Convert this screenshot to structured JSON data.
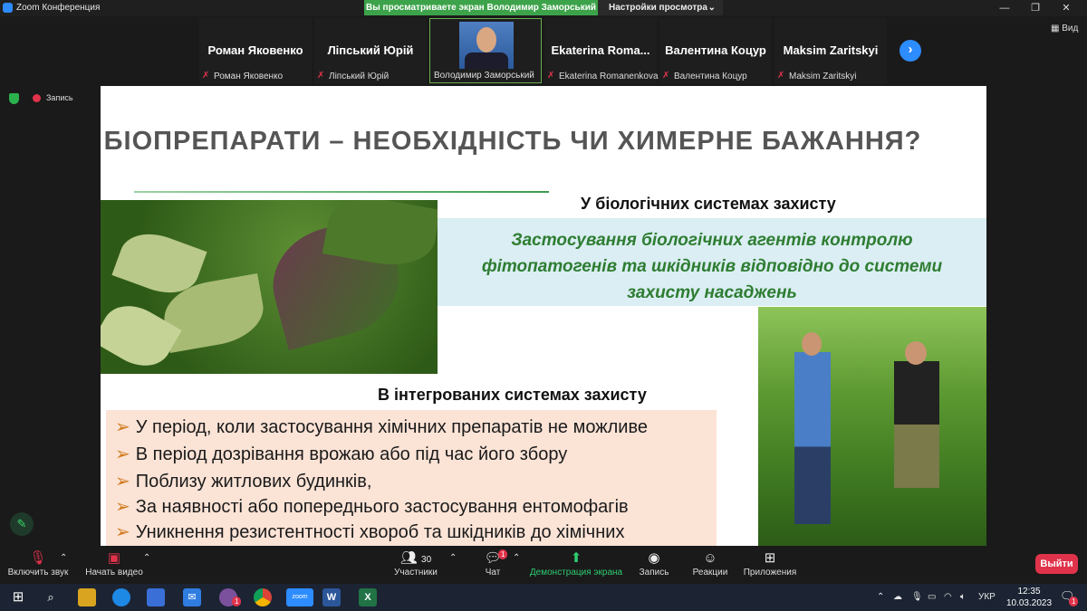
{
  "window": {
    "title": "Zoom Конференция",
    "share_banner": "Вы просматриваете экран Володимир Заморський",
    "view_settings": "Настройки просмотра",
    "minimize": "—",
    "maximize": "❐",
    "close": "✕"
  },
  "participants": [
    {
      "display": "Роман Яковенко",
      "label": "Роман Яковенко"
    },
    {
      "display": "Ліпський Юрій",
      "label": "Ліпський Юрій"
    },
    {
      "display": "",
      "label": "Володимир Заморський"
    },
    {
      "display": "Ekaterina   Roma...",
      "label": "Ekaterina Romanenkova"
    },
    {
      "display": "Валентина Коцур",
      "label": "Валентина Коцур"
    },
    {
      "display": "Maksim Zaritskyi",
      "label": "Maksim Zaritskyi"
    }
  ],
  "view_button": "Вид",
  "recording_label": "Запись",
  "slide": {
    "title": "БІОПРЕПАРАТИ – НЕОБХІДНІСТЬ ЧИ ХИМЕРНЕ БАЖАННЯ?",
    "heading_bio": "У біологічних системах захисту",
    "bio_text_1": "Застосування біологічних агентів контролю",
    "bio_text_2": "фітопатогенів та шкідників відповідно  до системи",
    "bio_text_3": "захисту насаджень",
    "heading_integrated": "В інтегрованих системах захисту",
    "bullets": [
      "У період, коли застосування хімічних препаратів не можливе",
      "В період дозрівання врожаю  або під час його збору",
      "Поблизу житлових будинків,",
      "За наявності або попереднього застосування ентомофагів",
      "Уникнення резистентності хвороб та шкідників до хімічних"
    ]
  },
  "toolbar": {
    "mute": "Включить звук",
    "video": "Начать видео",
    "participants": "Участники",
    "participants_count": "30",
    "chat": "Чат",
    "chat_badge": "1",
    "share": "Демонстрация экрана",
    "record": "Запись",
    "reactions": "Реакции",
    "apps": "Приложения",
    "leave": "Выйти"
  },
  "taskbar": {
    "lang": "УКР",
    "time": "12:35",
    "date": "10.03.2023",
    "notif_count": "1",
    "viber_badge": "1"
  }
}
